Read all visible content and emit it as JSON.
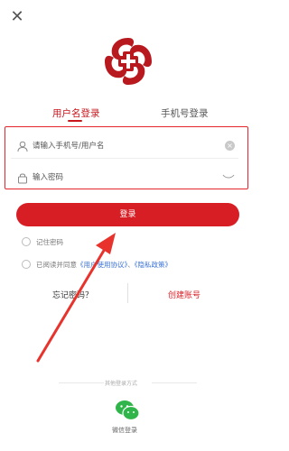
{
  "header": {
    "close_icon": "close-icon"
  },
  "logo": {
    "icon": "brand-cross-logo",
    "color": "#b8191f"
  },
  "tabs": [
    {
      "label": "用户名登录",
      "active": true
    },
    {
      "label": "手机号登录",
      "active": false
    }
  ],
  "form": {
    "username": {
      "placeholder": "请输入手机号/用户名",
      "icon": "user-icon",
      "clear_icon": "clear-icon"
    },
    "password": {
      "placeholder": "输入密码",
      "icon": "lock-icon",
      "toggle_icon": "eye-closed-icon"
    }
  },
  "login_button": "登录",
  "remember": "记住密码",
  "agreement": {
    "prefix": "已阅读并同意",
    "user_agreement": "《用户使用协议》",
    "sep": "、",
    "privacy": "《隐私政策》"
  },
  "links": {
    "forgot": "忘记密码？",
    "create": "创建账号"
  },
  "other": {
    "title": "其他登录方式",
    "wechat": "微信登录"
  },
  "colors": {
    "accent": "#d81e25",
    "link": "#3a72d6"
  }
}
